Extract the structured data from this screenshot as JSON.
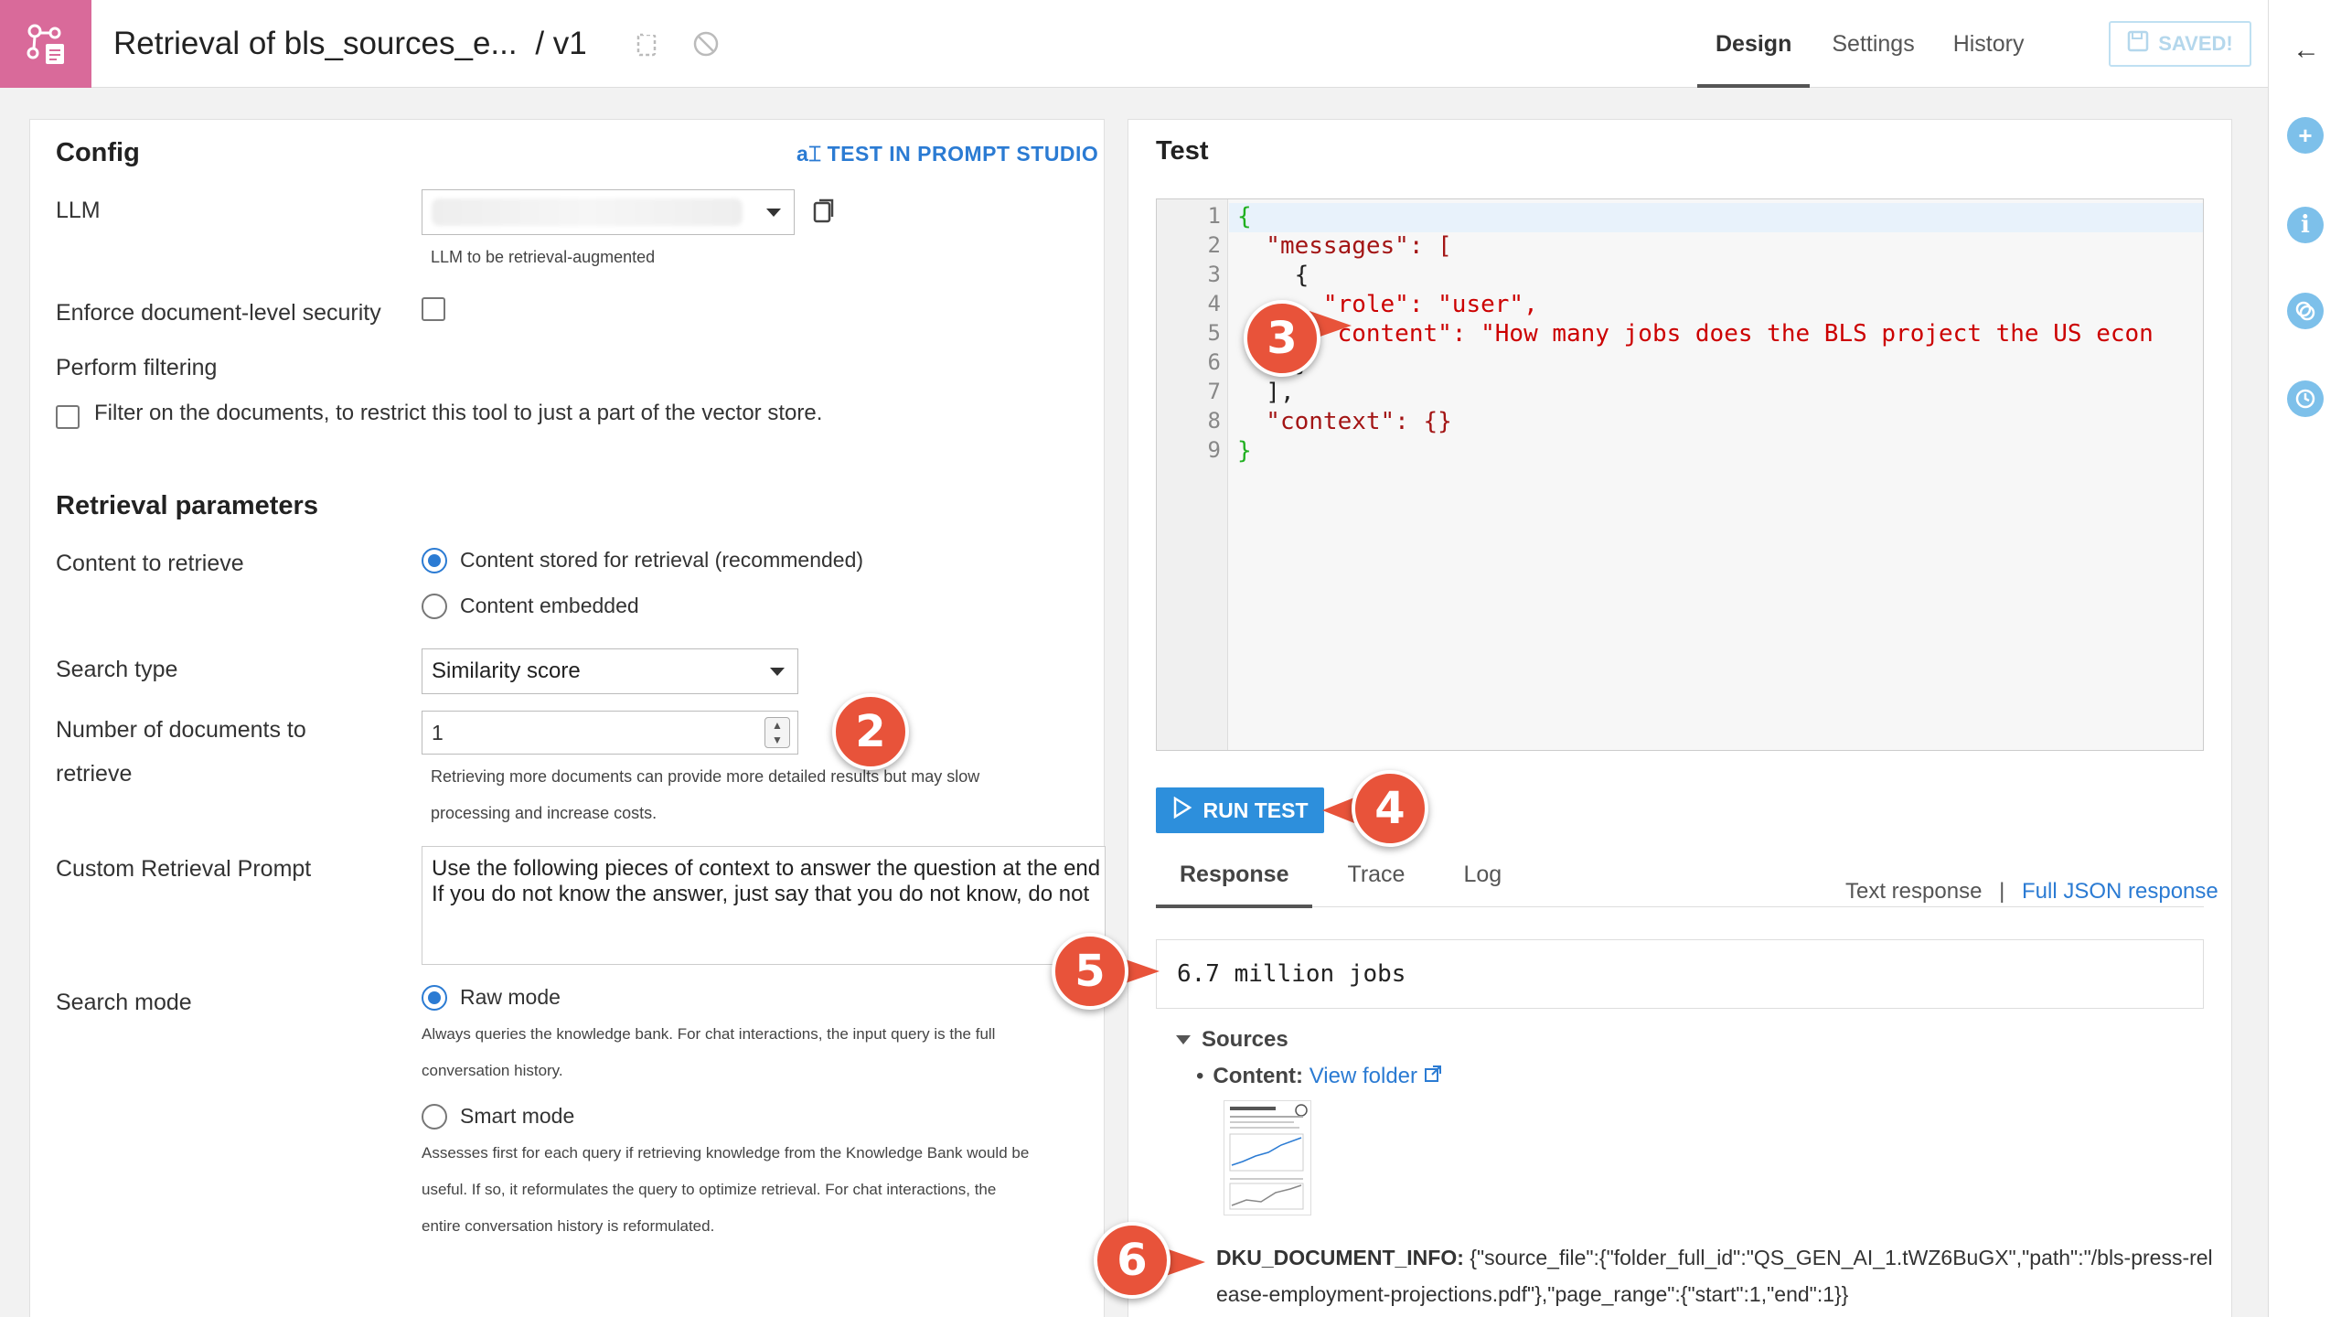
{
  "header": {
    "title": "Retrieval of bls_sources_e...",
    "version": "/ v1",
    "tabs": [
      {
        "label": "Design"
      },
      {
        "label": "Settings"
      },
      {
        "label": "History"
      }
    ],
    "saved_label": "SAVED!"
  },
  "config": {
    "title": "Config",
    "test_link": "TEST IN PROMPT STUDIO",
    "llm_label": "LLM",
    "llm_help": "LLM to be retrieval-augmented",
    "security_label": "Enforce document-level security",
    "filtering_label": "Perform filtering",
    "filter_text": "Filter on the documents, to restrict this tool to just a part of the vector store.",
    "retrieval_title": "Retrieval parameters",
    "content_label": "Content to retrieve",
    "content_options": [
      "Content stored for retrieval (recommended)",
      "Content embedded"
    ],
    "search_type_label": "Search type",
    "search_type_value": "Similarity score",
    "num_docs_label_1": "Number of documents to",
    "num_docs_label_2": "retrieve",
    "num_docs_value": "1",
    "num_docs_help_1": "Retrieving more documents can provide more detailed results but may slow",
    "num_docs_help_2": "processing and increase costs.",
    "prompt_label": "Custom Retrieval Prompt",
    "prompt_line_1": "Use the following pieces of context to answer the question at the end",
    "prompt_line_2": "If you do not know the answer, just say that you do not know, do not",
    "search_mode_label": "Search mode",
    "raw_mode": "Raw mode",
    "raw_help_1": "Always queries the knowledge bank. For chat interactions, the input query is the full",
    "raw_help_2": "conversation history.",
    "smart_mode": "Smart mode",
    "smart_help_1": "Assesses first for each query if retrieving knowledge from the Knowledge Bank would be",
    "smart_help_2": "useful. If so, it reformulates the query to optimize retrieval. For chat interactions, the",
    "smart_help_3": "entire conversation history is reformulated."
  },
  "test": {
    "title": "Test",
    "code_lines": [
      {
        "n": "1",
        "text": "{"
      },
      {
        "n": "2",
        "text": "  \"messages\": ["
      },
      {
        "n": "3",
        "text": "    {"
      },
      {
        "n": "4",
        "text": "      \"role\": \"user\","
      },
      {
        "n": "5",
        "text": "      \"content\": \"How many jobs does the BLS project the US econ"
      },
      {
        "n": "6",
        "text": "    }"
      },
      {
        "n": "7",
        "text": "  ],"
      },
      {
        "n": "8",
        "text": "  \"context\": {}"
      },
      {
        "n": "9",
        "text": "}"
      }
    ],
    "run_label": "RUN TEST",
    "result_tabs": [
      {
        "label": "Response"
      },
      {
        "label": "Trace"
      },
      {
        "label": "Log"
      }
    ],
    "text_response": "Text response",
    "separator": "|",
    "full_json": "Full JSON response",
    "response": "6.7 million jobs",
    "sources_label": "Sources",
    "content_key": "Content:",
    "view_folder": "View folder",
    "docinfo_key": "DKU_DOCUMENT_INFO:",
    "docinfo_value": "{\"source_file\":{\"folder_full_id\":\"QS_GEN_AI_1.tWZ6BuGX\",\"path\":\"/bls-press-release-employment-projections.pdf\"},\"page_range\":{\"start\":1,\"end\":1}}"
  },
  "callouts": [
    "2",
    "3",
    "4",
    "5",
    "6"
  ],
  "icons": [
    "app-icon",
    "copy-icon",
    "deploy-icon",
    "save-icon",
    "back-arrow-icon",
    "plus-icon",
    "info-icon",
    "chat-icon",
    "history-icon",
    "external-link-icon",
    "play-icon"
  ]
}
